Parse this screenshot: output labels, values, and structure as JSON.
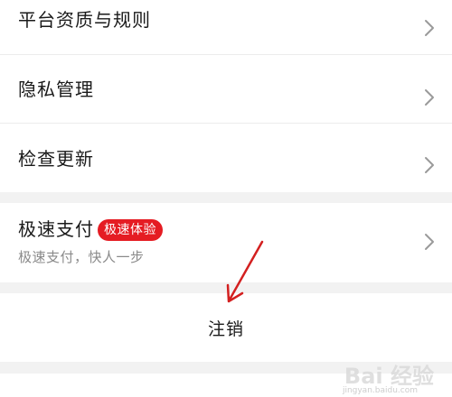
{
  "settings_list": {
    "items": [
      {
        "label": "平台资质与规则"
      },
      {
        "label": "隐私管理"
      },
      {
        "label": "检查更新"
      }
    ],
    "fast_pay": {
      "label": "极速支付",
      "badge": "极速体验",
      "subtitle": "极速支付，快人一步"
    },
    "logout_label": "注销"
  },
  "watermark": {
    "text": "Bai 经验",
    "sub": "jingyan.baidu.com"
  },
  "colors": {
    "badge_bg": "#e51c23",
    "annotation_arrow": "#d32020",
    "section_gap": "#f2f2f2"
  },
  "icons": {
    "row_chevron": "chevron-right-icon",
    "annotation": "arrow-annotation-icon"
  }
}
